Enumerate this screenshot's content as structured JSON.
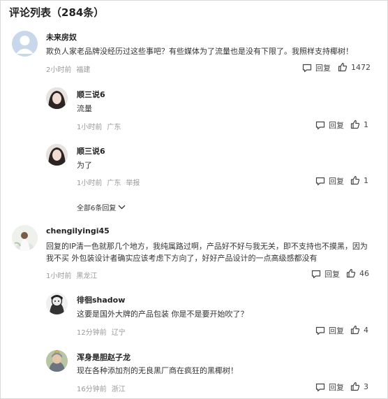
{
  "header": {
    "title": "评论列表（284条）"
  },
  "comments": [
    {
      "user": "未来房奴",
      "text": "欺负人家老品牌没经历过这些事吧？有些媒体为了流量也是没有下限了。我照样支持椰树！",
      "time": "2小时前",
      "location": "福建",
      "reply_label": "回复",
      "likes": "1472",
      "avatar_icon": "default-avatar-icon"
    },
    {
      "user": "顺三说6",
      "text": "流量",
      "time": "1小时前",
      "location": "广东",
      "reply_label": "回复",
      "likes": "1"
    },
    {
      "user": "顺三说6",
      "text": "为了",
      "time": "1小时前",
      "location": "广东",
      "report": "举报",
      "reply_label": "回复",
      "likes": "1"
    },
    {
      "user": "chengilyingi45",
      "text1": "回复的IP清一色就那几个地方，我纯属路过啊，产品好不好与我无关，即不支持也不摸黑，因为",
      "text2": "我不买 外包装设计者确实应该考虑下方向了，好好产品设计的一点高级感都没有",
      "time": "1小时前",
      "location": "黑龙江",
      "reply_label": "回复",
      "likes": "46"
    },
    {
      "user": "徘徊shadow",
      "text": "这要是国外大牌的产品包装 你是不是要开始吹了？",
      "time": "12分钟前",
      "location": "辽宁",
      "reply_label": "回复",
      "likes": "4"
    },
    {
      "user": "浑身是胆赵子龙",
      "text": "现在各种添加剂的无良黑厂商在疯狂的黑椰树！",
      "time": "16分钟前",
      "location": "浙江",
      "reply_label": "回复",
      "likes": "3"
    }
  ],
  "expand": {
    "label": "全部6条回复"
  },
  "colors": {
    "meta": "#999999",
    "text": "#333333",
    "name": "#222222"
  }
}
